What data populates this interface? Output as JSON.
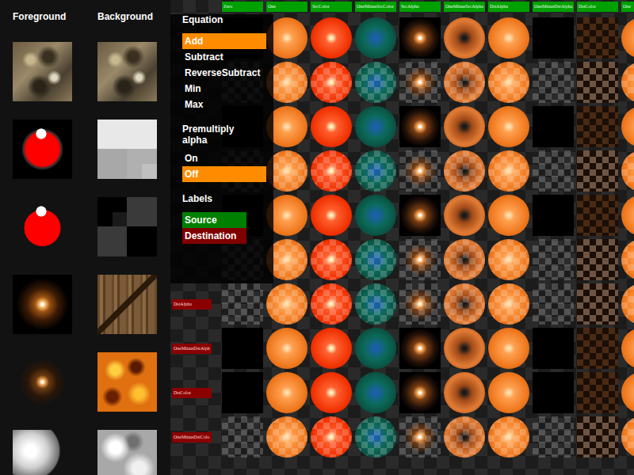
{
  "sidebar": {
    "foreground_title": "Foreground",
    "background_title": "Background",
    "foreground": [
      {
        "kind": "rock"
      },
      {
        "kind": "red-ball-black"
      },
      {
        "kind": "red-ball"
      },
      {
        "kind": "glow"
      },
      {
        "kind": "glow-dim"
      },
      {
        "kind": "sphere"
      }
    ],
    "background": [
      {
        "kind": "rock"
      },
      {
        "kind": "grey-blocks"
      },
      {
        "kind": "dark-blocks"
      },
      {
        "kind": "wood"
      },
      {
        "kind": "lava"
      },
      {
        "kind": "clouds"
      }
    ]
  },
  "panel": {
    "equation_title": "Equation",
    "equations": [
      {
        "label": "Add",
        "selected": true
      },
      {
        "label": "Subtract",
        "selected": false
      },
      {
        "label": "ReverseSubtract",
        "selected": false
      },
      {
        "label": "Min",
        "selected": false
      },
      {
        "label": "Max",
        "selected": false
      }
    ],
    "premultiply_title": "Premultiply alpha",
    "premultiply": [
      {
        "label": "On",
        "selected": false
      },
      {
        "label": "Off",
        "selected": true
      }
    ],
    "labels_title": "Labels",
    "labels": [
      {
        "label": "Source",
        "color": "#008000"
      },
      {
        "label": "Destination",
        "color": "#800000"
      }
    ]
  },
  "grid": {
    "columns": [
      {
        "label": "Zero",
        "kind": "black"
      },
      {
        "label": "One",
        "kind": "orange"
      },
      {
        "label": "SrcColor",
        "kind": "red"
      },
      {
        "label": "OneMinusSrcColor",
        "kind": "teal"
      },
      {
        "label": "SrcAlpha",
        "kind": "glow"
      },
      {
        "label": "OneMinusSrcAlpha",
        "kind": "ring"
      },
      {
        "label": "DstAlpha",
        "kind": "orange"
      },
      {
        "label": "OneMinusDstAlpha",
        "kind": "empty"
      },
      {
        "label": "DstColor",
        "kind": "brown"
      },
      {
        "label": "One",
        "kind": "orange"
      }
    ],
    "rows": [
      {
        "checker": false
      },
      {
        "checker": true
      },
      {
        "checker": false
      },
      {
        "checker": true
      },
      {
        "checker": false
      },
      {
        "checker": true
      },
      {
        "label": "DstAlpha",
        "checker": true
      },
      {
        "label": "OneMinusDstAlph",
        "checker": false
      },
      {
        "label": "DstColor",
        "checker": false
      },
      {
        "label": "OneMinusDstColo",
        "checker": true
      }
    ]
  }
}
